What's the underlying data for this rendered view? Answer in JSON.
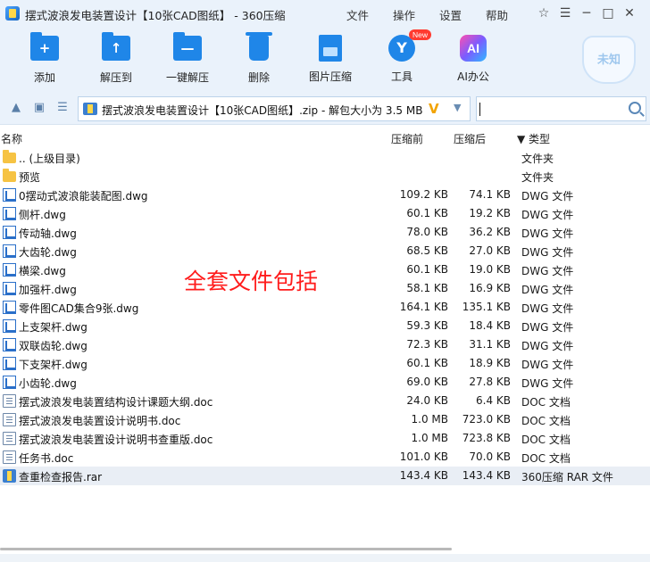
{
  "window": {
    "title": "摆式波浪发电装置设计【10张CAD图纸】 - 360压缩",
    "menu": [
      "文件",
      "操作",
      "设置",
      "帮助"
    ]
  },
  "toolbar": {
    "items": [
      {
        "label": "添加",
        "icon": "add-folder-icon",
        "glyph": "+"
      },
      {
        "label": "解压到",
        "icon": "extract-to-icon",
        "glyph": "↑"
      },
      {
        "label": "一键解压",
        "icon": "one-click-extract-icon",
        "glyph": "—"
      },
      {
        "label": "删除",
        "icon": "trash-icon"
      },
      {
        "label": "图片压缩",
        "icon": "image-compress-icon"
      },
      {
        "label": "工具",
        "icon": "tools-icon",
        "glyph": "Y",
        "badge": "New"
      },
      {
        "label": "AI办公",
        "icon": "ai-office-icon",
        "glyph": "AI"
      }
    ],
    "shield_text": "未知"
  },
  "address": {
    "path": "摆式波浪发电装置设计【10张CAD图纸】.zip - 解包大小为 3.5 MB",
    "v_glyph": "V",
    "dropdown_glyph": "▼",
    "search_value": ""
  },
  "columns": {
    "name": "名称",
    "compressed": "压缩前",
    "uncompressed": "压缩后",
    "type": "▼ 类型"
  },
  "files": [
    {
      "name": ".. (上级目录)",
      "compressed": "",
      "uncompressed": "",
      "type": "文件夹",
      "kind": "folder"
    },
    {
      "name": "预览",
      "compressed": "",
      "uncompressed": "",
      "type": "文件夹",
      "kind": "folder"
    },
    {
      "name": "0摆动式波浪能装配图.dwg",
      "compressed": "109.2 KB",
      "uncompressed": "74.1 KB",
      "type": "DWG 文件",
      "kind": "dwg"
    },
    {
      "name": "侧杆.dwg",
      "compressed": "60.1 KB",
      "uncompressed": "19.2 KB",
      "type": "DWG 文件",
      "kind": "dwg"
    },
    {
      "name": "传动轴.dwg",
      "compressed": "78.0 KB",
      "uncompressed": "36.2 KB",
      "type": "DWG 文件",
      "kind": "dwg"
    },
    {
      "name": "大齿轮.dwg",
      "compressed": "68.5 KB",
      "uncompressed": "27.0 KB",
      "type": "DWG 文件",
      "kind": "dwg"
    },
    {
      "name": "横梁.dwg",
      "compressed": "60.1 KB",
      "uncompressed": "19.0 KB",
      "type": "DWG 文件",
      "kind": "dwg"
    },
    {
      "name": "加强杆.dwg",
      "compressed": "58.1 KB",
      "uncompressed": "16.9 KB",
      "type": "DWG 文件",
      "kind": "dwg"
    },
    {
      "name": "零件图CAD集合9张.dwg",
      "compressed": "164.1 KB",
      "uncompressed": "135.1 KB",
      "type": "DWG 文件",
      "kind": "dwg"
    },
    {
      "name": "上支架杆.dwg",
      "compressed": "59.3 KB",
      "uncompressed": "18.4 KB",
      "type": "DWG 文件",
      "kind": "dwg"
    },
    {
      "name": "双联齿轮.dwg",
      "compressed": "72.3 KB",
      "uncompressed": "31.1 KB",
      "type": "DWG 文件",
      "kind": "dwg"
    },
    {
      "name": "下支架杆.dwg",
      "compressed": "60.1 KB",
      "uncompressed": "18.9 KB",
      "type": "DWG 文件",
      "kind": "dwg"
    },
    {
      "name": "小齿轮.dwg",
      "compressed": "69.0 KB",
      "uncompressed": "27.8 KB",
      "type": "DWG 文件",
      "kind": "dwg"
    },
    {
      "name": "摆式波浪发电装置结构设计课题大纲.doc",
      "compressed": "24.0 KB",
      "uncompressed": "6.4 KB",
      "type": "DOC 文档",
      "kind": "doc"
    },
    {
      "name": "摆式波浪发电装置设计说明书.doc",
      "compressed": "1.0 MB",
      "uncompressed": "723.0 KB",
      "type": "DOC 文档",
      "kind": "doc"
    },
    {
      "name": "摆式波浪发电装置设计说明书查重版.doc",
      "compressed": "1.0 MB",
      "uncompressed": "723.8 KB",
      "type": "DOC 文档",
      "kind": "doc"
    },
    {
      "name": "任务书.doc",
      "compressed": "101.0 KB",
      "uncompressed": "70.0 KB",
      "type": "DOC 文档",
      "kind": "doc"
    },
    {
      "name": "查重检查报告.rar",
      "compressed": "143.4 KB",
      "uncompressed": "143.4 KB",
      "type": "360压缩 RAR 文件",
      "kind": "rar",
      "selected": true
    }
  ],
  "overlay_text": "全套文件包括"
}
